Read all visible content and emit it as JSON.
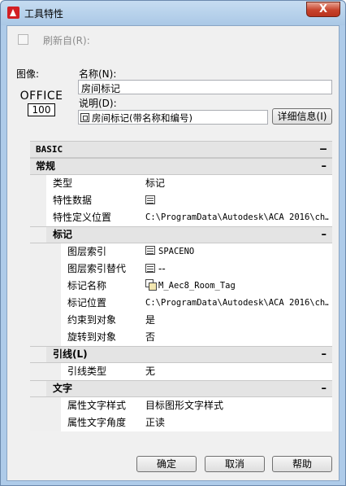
{
  "window": {
    "title": "工具特性",
    "close_label": "X"
  },
  "refresh": {
    "label": "刷新自(R):",
    "checked": false
  },
  "image": {
    "label": "图像:",
    "office_text": "OFFICE",
    "office_number": "100"
  },
  "name": {
    "label": "名称(N):",
    "value": "房间标记"
  },
  "description": {
    "label": "说明(D):",
    "value": "房间标记(带名称和编号)"
  },
  "details_button": "详细信息(I)",
  "grid": {
    "basic_label": "BASIC",
    "general": {
      "label": "常规",
      "rows": [
        {
          "name": "类型",
          "value": "标记"
        },
        {
          "name": "特性数据",
          "value": ""
        },
        {
          "name": "特性定义位置",
          "value": "C:\\ProgramData\\Autodesk\\ACA  2016\\ch…"
        }
      ]
    },
    "tag": {
      "label": "标记",
      "rows": [
        {
          "name": "图层索引",
          "value": "SPACENO"
        },
        {
          "name": "图层索引替代",
          "value": "--"
        },
        {
          "name": "标记名称",
          "value": "M_Aec8_Room_Tag"
        },
        {
          "name": "标记位置",
          "value": "C:\\ProgramData\\Autodesk\\ACA  2016\\ch…"
        },
        {
          "name": "约束到对象",
          "value": "是"
        },
        {
          "name": "旋转到对象",
          "value": "否"
        }
      ]
    },
    "leader": {
      "label": "引线(L)",
      "rows": [
        {
          "name": "引线类型",
          "value": "无"
        }
      ]
    },
    "text": {
      "label": "文字",
      "rows": [
        {
          "name": "属性文字样式",
          "value": "目标图形文字样式"
        },
        {
          "name": "属性文字角度",
          "value": "正读"
        }
      ]
    },
    "collapse_glyph": "–"
  },
  "buttons": {
    "ok": "确定",
    "cancel": "取消",
    "help": "帮助"
  }
}
